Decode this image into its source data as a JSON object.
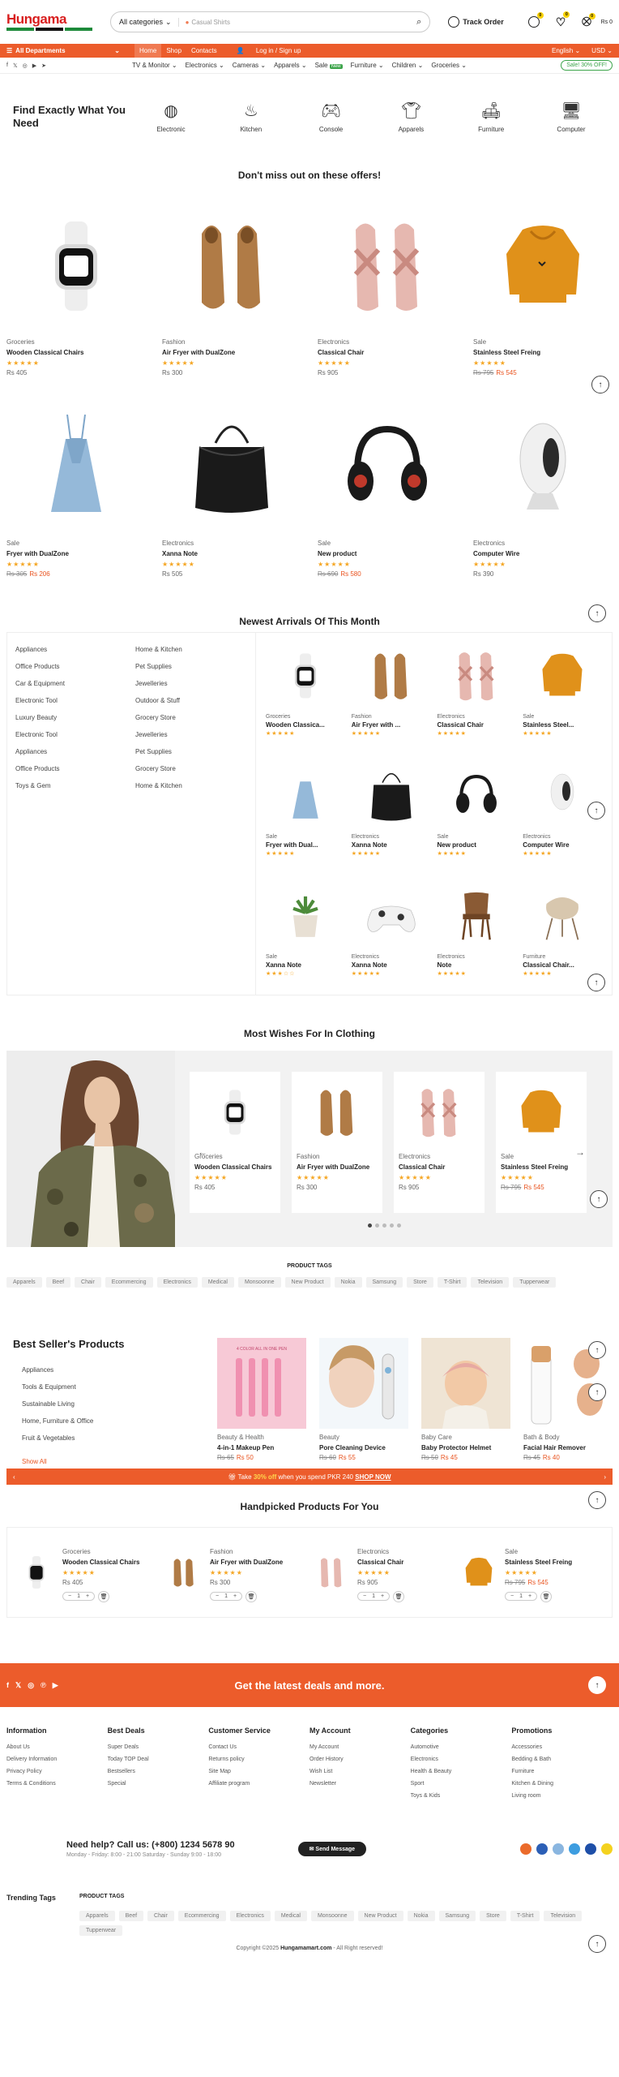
{
  "header": {
    "logo_text": "Hungama",
    "category_select": "All categories",
    "search_placeholder": "Casual Shirts",
    "track_order": "Track Order",
    "compare_count": "0",
    "wishlist_count": "0",
    "cart_count": "0",
    "cart_total": "Rs 0"
  },
  "nav": {
    "departments": "All Departments",
    "links": [
      "Home",
      "Shop",
      "Contacts",
      "Log in / Sign up"
    ],
    "language": "English",
    "currency": "USD"
  },
  "subnav": {
    "categories": [
      "TV & Monitor",
      "Electronics",
      "Cameras",
      "Apparels",
      "Sale",
      "Furniture",
      "Children",
      "Groceries"
    ],
    "new_badge": "New",
    "sale_badge": "Sale! 30% OFF!"
  },
  "find": {
    "title": "Find Exactly What You Need",
    "categories": [
      {
        "label": "Electronic",
        "icon": "ring-icon"
      },
      {
        "label": "Kitchen",
        "icon": "cooking-pot-icon"
      },
      {
        "label": "Console",
        "icon": "gamepad-icon"
      },
      {
        "label": "Apparels",
        "icon": "tshirt-icon"
      },
      {
        "label": "Furniture",
        "icon": "sofa-icon"
      },
      {
        "label": "Computer",
        "icon": "monitor-icon"
      }
    ]
  },
  "offers": {
    "title": "Don't miss out on these offers!",
    "products": [
      {
        "category": "Groceries",
        "name": "Wooden Classical Chairs",
        "old": "",
        "price": "Rs 405"
      },
      {
        "category": "Fashion",
        "name": "Air Fryer with DualZone",
        "old": "",
        "price": "Rs 300"
      },
      {
        "category": "Electronics",
        "name": "Classical Chair",
        "old": "",
        "price": "Rs 905"
      },
      {
        "category": "Sale",
        "name": "Stainless Steel Freing",
        "old": "Rs 795",
        "price": "Rs 545"
      },
      {
        "category": "Sale",
        "name": "Fryer with DualZone",
        "old": "Rs 305",
        "price": "Rs 206"
      },
      {
        "category": "Electronics",
        "name": "Xanna Note",
        "old": "",
        "price": "Rs 505"
      },
      {
        "category": "Sale",
        "name": "New product",
        "old": "Rs 690",
        "price": "Rs 580"
      },
      {
        "category": "Electronics",
        "name": "Computer Wire",
        "old": "",
        "price": "Rs 390"
      }
    ]
  },
  "arrivals": {
    "title": "Newest Arrivals Of This Month",
    "col1": [
      "Appliances",
      "Office Products",
      "Car & Equipment",
      "Electronic Tool",
      "Luxury Beauty",
      "Electronic Tool",
      "Appliances",
      "Office Products",
      "Toys & Gem"
    ],
    "col2": [
      "Home & Kitchen",
      "Pet Supplies",
      "Jewelleries",
      "Outdoor & Stuff",
      "Grocery Store",
      "Jewelleries",
      "Pet Supplies",
      "Grocery Store",
      "Home & Kitchen"
    ],
    "products": [
      {
        "category": "Groceries",
        "name": "Wooden Classica..."
      },
      {
        "category": "Fashion",
        "name": "Air Fryer with ..."
      },
      {
        "category": "Electronics",
        "name": "Classical Chair"
      },
      {
        "category": "Sale",
        "name": "Stainless Steel..."
      },
      {
        "category": "Sale",
        "name": "Fryer with Dual..."
      },
      {
        "category": "Electronics",
        "name": "Xanna Note"
      },
      {
        "category": "Sale",
        "name": "New product"
      },
      {
        "category": "Electronics",
        "name": "Computer Wire"
      },
      {
        "category": "Sale",
        "name": "Xanna Note"
      },
      {
        "category": "Electronics",
        "name": "Xanna Note"
      },
      {
        "category": "Electronics",
        "name": "Note"
      },
      {
        "category": "Furniture",
        "name": "Classical Chair..."
      }
    ]
  },
  "wishes": {
    "title": "Most Wishes For In Clothing",
    "products": [
      {
        "category": "Groceries",
        "name": "Wooden Classical Chairs",
        "old": "",
        "price": "Rs 405"
      },
      {
        "category": "Fashion",
        "name": "Air Fryer with DualZone",
        "old": "",
        "price": "Rs 300"
      },
      {
        "category": "Electronics",
        "name": "Classical Chair",
        "old": "",
        "price": "Rs 905"
      },
      {
        "category": "Sale",
        "name": "Stainless Steel Freing",
        "old": "Rs 795",
        "price": "Rs 545"
      }
    ]
  },
  "product_tags": {
    "title": "PRODUCT TAGS",
    "tags": [
      "Apparels",
      "Beef",
      "Chair",
      "Ecommercing",
      "Electronics",
      "Medical",
      "Monsoonne",
      "New Product",
      "Nokia",
      "Samsung",
      "Store",
      "T-Shirt",
      "Television",
      "Tupperwear"
    ]
  },
  "best": {
    "title": "Best Seller's Products",
    "links": [
      "Appliances",
      "Tools & Equipment",
      "Sustainable Living",
      "Home, Furniture & Office",
      "Fruit & Vegetables"
    ],
    "show_all": "Show All",
    "products": [
      {
        "category": "Beauty & Health",
        "name": "4-in-1 Makeup Pen",
        "old": "Rs 65",
        "price": "Rs 50"
      },
      {
        "category": "Beauty",
        "name": "Pore Cleaning Device",
        "old": "Rs 60",
        "price": "Rs 55"
      },
      {
        "category": "Baby Care",
        "name": "Baby Protector Helmet",
        "old": "Rs 50",
        "price": "Rs 45"
      },
      {
        "category": "Bath & Body",
        "name": "Facial Hair Remover",
        "old": "Rs 45",
        "price": "Rs 40"
      }
    ],
    "pen_caption": "4 COLOR ALL IN ONE PEN"
  },
  "promo": {
    "pre": "Take",
    "pct": "30% off",
    "post": "when you spend PKR 240",
    "link": "SHOP NOW"
  },
  "handpicked": {
    "title": "Handpicked Products For You",
    "products": [
      {
        "category": "Groceries",
        "name": "Wooden Classical Chairs",
        "old": "",
        "price": "Rs 405"
      },
      {
        "category": "Fashion",
        "name": "Air Fryer with DualZone",
        "old": "",
        "price": "Rs 300"
      },
      {
        "category": "Electronics",
        "name": "Classical Chair",
        "old": "",
        "price": "Rs 905"
      },
      {
        "category": "Sale",
        "name": "Stainless Steel Freing",
        "old": "Rs 795",
        "price": "Rs 545"
      }
    ],
    "qty": "1"
  },
  "newsletter": {
    "text": "Get the latest deals and more."
  },
  "footer": {
    "columns": [
      {
        "title": "Information",
        "links": [
          "About Us",
          "Delivery Information",
          "Privacy Policy",
          "Terms & Conditions"
        ]
      },
      {
        "title": "Best Deals",
        "links": [
          "Super Deals",
          "Today TOP Deal",
          "Bestsellers",
          "Special"
        ]
      },
      {
        "title": "Customer Service",
        "links": [
          "Contact Us",
          "Returns policy",
          "Site Map",
          "Affiliate program"
        ]
      },
      {
        "title": "My Account",
        "links": [
          "My Account",
          "Order History",
          "Wish List",
          "Newsletter"
        ]
      },
      {
        "title": "Categories",
        "links": [
          "Automotive",
          "Electronics",
          "Health & Beauty",
          "Sport",
          "Toys & Kids"
        ]
      },
      {
        "title": "Promotions",
        "links": [
          "Accessories",
          "Bedding & Bath",
          "Furniture",
          "Kitchen & Dining",
          "Living room"
        ]
      }
    ],
    "help_title": "Need help? Call us: (+800) 1234 5678 90",
    "help_hours": "Monday - Friday: 8:00 - 21:00 Saturday - Sunday 9:00 - 18:00",
    "send_message": "Send Message",
    "trending_title": "Trending Tags",
    "copyright_pre": "Copyright ©2025",
    "copyright_site": "Hungamamart.com",
    "copyright_post": "- All Right reserved!"
  },
  "colors": {
    "brand": "#ec5c2b",
    "star": "#f5a623",
    "sale_green": "#3ca44a"
  }
}
